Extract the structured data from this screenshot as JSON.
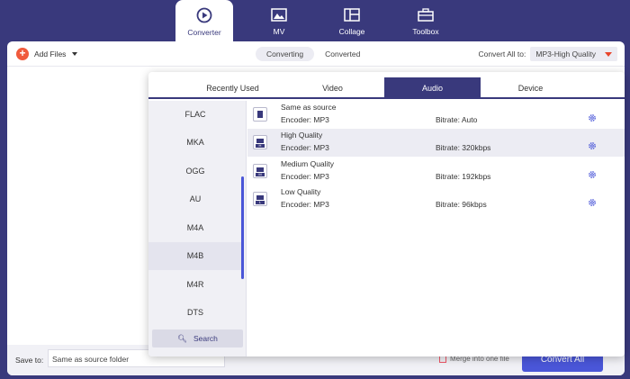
{
  "nav": {
    "items": [
      {
        "label": "Converter",
        "icon": "converter-icon",
        "active": true
      },
      {
        "label": "MV",
        "icon": "mv-icon",
        "active": false
      },
      {
        "label": "Collage",
        "icon": "collage-icon",
        "active": false
      },
      {
        "label": "Toolbox",
        "icon": "toolbox-icon",
        "active": false
      }
    ]
  },
  "toolbar": {
    "add_files": "Add Files",
    "tabs": [
      "Converting",
      "Converted"
    ],
    "convert_all_label": "Convert All to:",
    "convert_all_value": "MP3-High Quality"
  },
  "popup": {
    "tabs": [
      "Recently Used",
      "Video",
      "Audio",
      "Device"
    ],
    "active_tab": "Audio",
    "formats": [
      "FLAC",
      "MKA",
      "OGG",
      "AU",
      "M4A",
      "M4B",
      "M4R",
      "DTS"
    ],
    "selected_format": "M4B",
    "search_label": "Search",
    "qualities": [
      {
        "name": "Same as source",
        "encoder": "Encoder: MP3",
        "bitrate": "Bitrate: Auto"
      },
      {
        "name": "High Quality",
        "encoder": "Encoder: MP3",
        "bitrate": "Bitrate: 320kbps"
      },
      {
        "name": "Medium Quality",
        "encoder": "Encoder: MP3",
        "bitrate": "Bitrate: 192kbps"
      },
      {
        "name": "Low Quality",
        "encoder": "Encoder: MP3",
        "bitrate": "Bitrate: 96kbps"
      }
    ],
    "quality_badges": [
      "",
      "H",
      "M",
      "L"
    ]
  },
  "bottom": {
    "save_to_label": "Save to:",
    "save_to_value": "Same as source folder",
    "merge_label": "Merge into one file",
    "convert_all_button": "Convert All"
  },
  "colors": {
    "brand": "#39397c",
    "accent": "#4a56d8",
    "add": "#f05a3c"
  }
}
